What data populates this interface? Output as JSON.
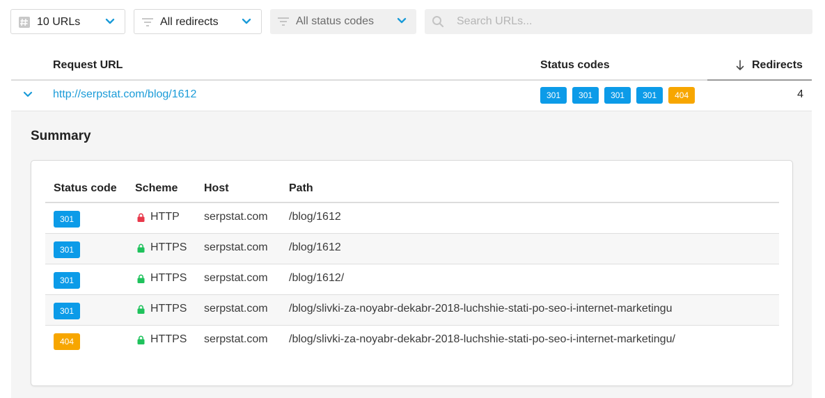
{
  "toolbar": {
    "urls_filter": {
      "label": "10 URLs"
    },
    "redirects_filter": {
      "label": "All redirects"
    },
    "status_filter": {
      "label": "All status codes"
    },
    "search": {
      "placeholder": "Search URLs...",
      "value": ""
    }
  },
  "table": {
    "headers": {
      "request_url": "Request URL",
      "status_codes": "Status codes",
      "redirects": "Redirects"
    },
    "sort": {
      "column": "Redirects",
      "direction": "descending"
    },
    "rows": [
      {
        "url": "http://serpstat.com/blog/1612",
        "status_codes": [
          "301",
          "301",
          "301",
          "301",
          "404"
        ],
        "redirects": "4",
        "expanded": true
      }
    ]
  },
  "summary": {
    "title": "Summary",
    "headers": {
      "status_code": "Status code",
      "scheme": "Scheme",
      "host": "Host",
      "path": "Path"
    },
    "rows": [
      {
        "status": "301",
        "scheme": "HTTP",
        "secure": false,
        "host": "serpstat.com",
        "path": "/blog/1612"
      },
      {
        "status": "301",
        "scheme": "HTTPS",
        "secure": true,
        "host": "serpstat.com",
        "path": "/blog/1612"
      },
      {
        "status": "301",
        "scheme": "HTTPS",
        "secure": true,
        "host": "serpstat.com",
        "path": "/blog/1612/"
      },
      {
        "status": "301",
        "scheme": "HTTPS",
        "secure": true,
        "host": "serpstat.com",
        "path": "/blog/slivki-za-noyabr-dekabr-2018-luchshie-stati-po-seo-i-internet-marketingu"
      },
      {
        "status": "404",
        "scheme": "HTTPS",
        "secure": true,
        "host": "serpstat.com",
        "path": "/blog/slivki-za-noyabr-dekabr-2018-luchshie-stati-po-seo-i-internet-marketingu/"
      }
    ]
  },
  "icons": {
    "urls_filter": "hash-icon",
    "redirects_filter": "filter-icon",
    "status_filter": "filter-icon",
    "search": "search-icon",
    "sort": "arrow-down-icon",
    "expand": "chevron-down-icon",
    "insecure_scheme": "lock-icon",
    "secure_scheme": "lock-icon"
  },
  "colors": {
    "accent": "#1a9bd8",
    "status_301": "#0c9be8",
    "status_404": "#f7a600",
    "lock_insecure": "#e8394b",
    "lock_secure": "#1fc25c"
  }
}
